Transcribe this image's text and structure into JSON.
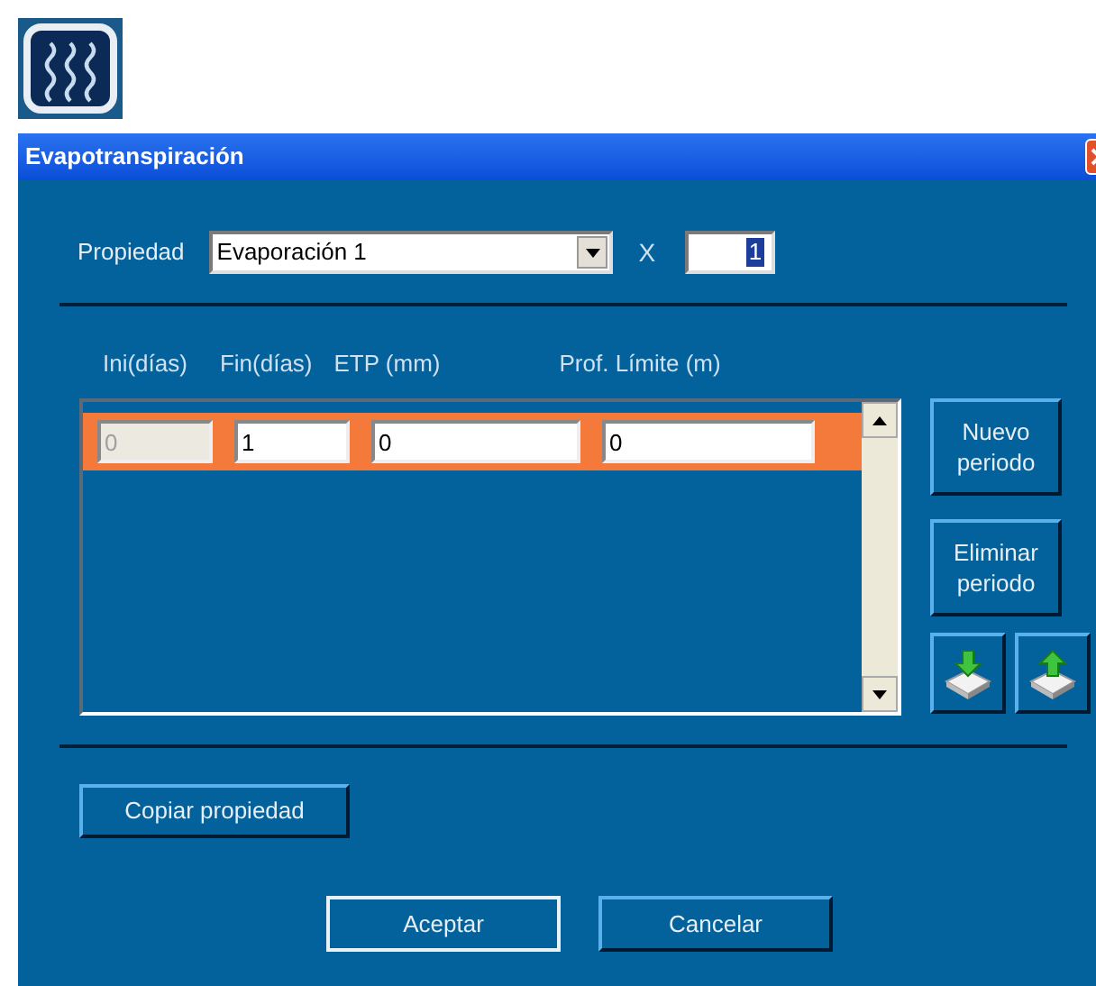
{
  "window": {
    "title": "Evapotranspiración"
  },
  "property": {
    "label": "Propiedad",
    "value": "Evaporación 1",
    "multiplier_label": "X",
    "multiplier": "1"
  },
  "table": {
    "columns": [
      "Ini(días)",
      "Fin(días)",
      "ETP (mm)",
      "Prof. Límite (m)"
    ],
    "rows": [
      {
        "selected": true,
        "cells": [
          {
            "value": "0",
            "disabled": true
          },
          {
            "value": "1",
            "disabled": false
          },
          {
            "value": "0",
            "disabled": false
          },
          {
            "value": "0",
            "disabled": false
          }
        ]
      }
    ]
  },
  "side_buttons": [
    "Nuevo periodo",
    "Eliminar periodo"
  ],
  "copy_button": "Copiar propiedad",
  "buttons": [
    {
      "label": "Aceptar",
      "default": true
    },
    {
      "label": "Cancelar",
      "default": false
    }
  ]
}
